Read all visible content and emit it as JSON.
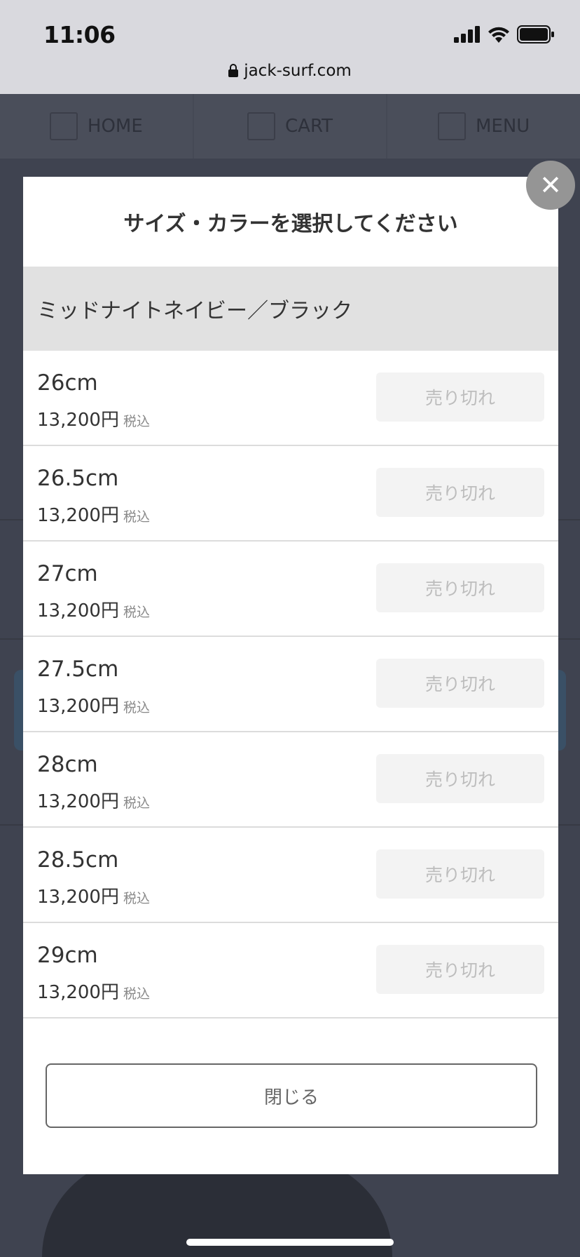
{
  "status_bar": {
    "time": "11:06",
    "url": "jack-surf.com"
  },
  "nav": {
    "items": [
      {
        "label": "HOME",
        "icon": "home-icon"
      },
      {
        "label": "CART",
        "icon": "cart-icon"
      },
      {
        "label": "MENU",
        "icon": "menu-icon"
      }
    ]
  },
  "modal": {
    "title": "サイズ・カラーを選択してください",
    "color_name": "ミッドナイトネイビー／ブラック",
    "rows": [
      {
        "size": "26cm",
        "price": "13,200円",
        "tax": "税込",
        "status": "売り切れ"
      },
      {
        "size": "26.5cm",
        "price": "13,200円",
        "tax": "税込",
        "status": "売り切れ"
      },
      {
        "size": "27cm",
        "price": "13,200円",
        "tax": "税込",
        "status": "売り切れ"
      },
      {
        "size": "27.5cm",
        "price": "13,200円",
        "tax": "税込",
        "status": "売り切れ"
      },
      {
        "size": "28cm",
        "price": "13,200円",
        "tax": "税込",
        "status": "売り切れ"
      },
      {
        "size": "28.5cm",
        "price": "13,200円",
        "tax": "税込",
        "status": "売り切れ"
      },
      {
        "size": "29cm",
        "price": "13,200円",
        "tax": "税込",
        "status": "売り切れ"
      }
    ],
    "close_label": "閉じる",
    "x_icon": "close-icon"
  }
}
